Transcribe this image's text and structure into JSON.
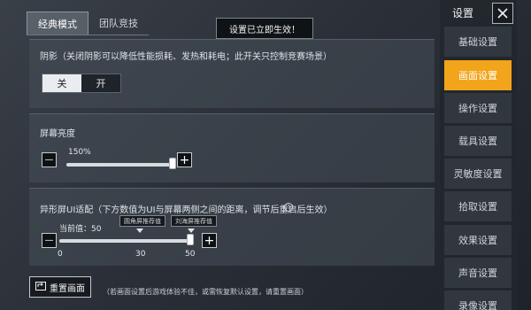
{
  "top_tabs": {
    "classic": "经典模式",
    "team": "团队竞技"
  },
  "toast": "设置已立即生效！",
  "shadow": {
    "label": "阴影（关闭阴影可以降低性能损耗、发热和耗电；此开关只控制竞赛场景）",
    "off_label": "关",
    "on_label": "开",
    "selected": "关"
  },
  "brightness": {
    "label": "屏幕亮度",
    "value_text": "150%",
    "minus": "—",
    "plus": "+",
    "fill_fraction": 0.98
  },
  "notch": {
    "label": "异形屏UI适配（下方数值为UI与屏幕两侧之间的距离，调节后重启后生效）",
    "help": "?",
    "current_text": "当前值：50",
    "marker_left": "圆角屏推荐值",
    "marker_right": "刘海屏推荐值",
    "tick_min": "0",
    "tick_mid": "30",
    "tick_max": "50",
    "minus": "—",
    "plus": "+",
    "fill_fraction": 1.0
  },
  "reset": {
    "label": "重置画面",
    "note": "（若画面设置后游戏体验不佳，或需恢复默认设置，请重置画面）"
  },
  "sidebar": {
    "title": "设置",
    "close": "✕",
    "items": [
      {
        "label": "基础设置"
      },
      {
        "label": "画面设置"
      },
      {
        "label": "操作设置"
      },
      {
        "label": "载具设置"
      },
      {
        "label": "灵敏度设置"
      },
      {
        "label": "拾取设置"
      },
      {
        "label": "效果设置"
      },
      {
        "label": "声音设置"
      },
      {
        "label": "录像设置"
      }
    ],
    "active_index": 1
  },
  "colors": {
    "accent": "#f2a41a",
    "panel": "#464e58"
  }
}
